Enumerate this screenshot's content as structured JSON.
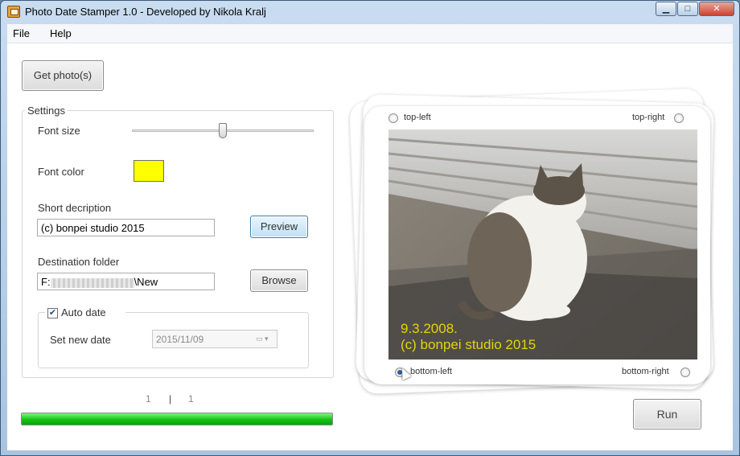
{
  "window": {
    "title": "Photo Date Stamper 1.0 - Developed by Nikola Kralj"
  },
  "menu": {
    "items": [
      "File",
      "Help"
    ]
  },
  "toolbar": {
    "get_photos_label": "Get photo(s)"
  },
  "settings": {
    "title": "Settings",
    "font_size_label": "Font size",
    "font_size_value": 0.5,
    "font_color_label": "Font color",
    "font_color": "#ffff00",
    "short_description_label": "Short decription",
    "short_description_value": "(c) bonpei studio 2015",
    "preview_label": "Preview",
    "destination_label": "Destination folder",
    "destination_prefix": "F:",
    "destination_suffix": "\\New",
    "browse_label": "Browse",
    "auto_date": {
      "label": "Auto date",
      "checked": true,
      "set_date_label": "Set new date",
      "date_value": "2015/11/09"
    }
  },
  "progress": {
    "current": "1",
    "separator": "|",
    "total": "1",
    "fill": 1.0
  },
  "preview": {
    "positions": {
      "top_left": "top-left",
      "top_right": "top-right",
      "bottom_left": "bottom-left",
      "bottom_right": "bottom-right",
      "selected": "bottom-left"
    },
    "stamp_date": "9.3.2008.",
    "stamp_text": "(c) bonpei studio 2015"
  },
  "actions": {
    "run_label": "Run"
  },
  "colors": {
    "progress_green": "#16c316",
    "stamp_color": "#e6d500",
    "accent_blue": "#3c7fb1"
  }
}
